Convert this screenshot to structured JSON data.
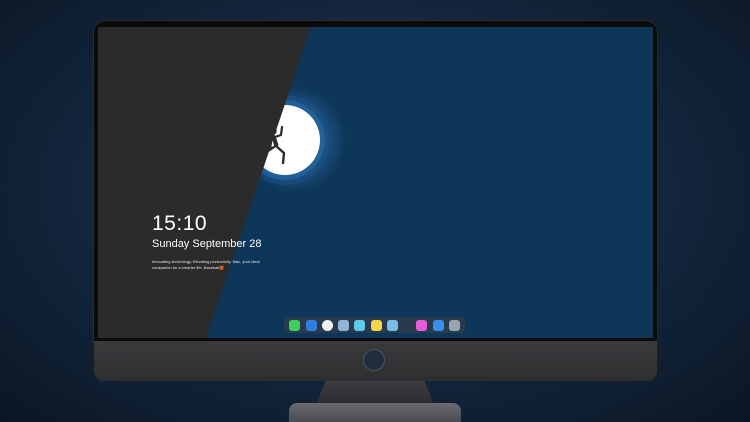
{
  "lock_screen": {
    "time": "15:10",
    "date": "Sunday September 28",
    "tagline": "Innovating technology, Elevating productivity. Mac, your ideal companion for a smarter life, Baseball🏀"
  },
  "dock": {
    "items": [
      {
        "name": "messages",
        "color": "#3fcf5a"
      },
      {
        "name": "finder",
        "color": "#2f7de0"
      },
      {
        "name": "clock",
        "color": "#f2f2f2"
      },
      {
        "name": "preview",
        "color": "#8fb6d9"
      },
      {
        "name": "videos",
        "color": "#5ec9e8"
      },
      {
        "name": "notes",
        "color": "#f5d54a"
      },
      {
        "name": "photos",
        "color": "#7bbfe6"
      },
      {
        "name": "music",
        "color": "#e55cd6"
      },
      {
        "name": "app-store",
        "color": "#3b8ef0"
      },
      {
        "name": "system",
        "color": "#9aa4b0"
      }
    ]
  },
  "colors": {
    "wallpaper_blue": "#0d3658",
    "wallpaper_dark": "#2b2b2c",
    "moon": "#ffffff"
  }
}
